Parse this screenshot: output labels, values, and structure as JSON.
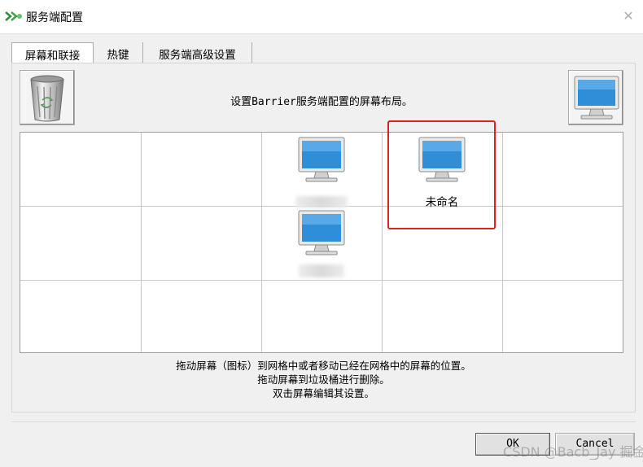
{
  "window": {
    "title": "服务端配置",
    "close_glyph": "✕"
  },
  "tabs": [
    {
      "label": "屏幕和联接",
      "active": true
    },
    {
      "label": "热键",
      "active": false
    },
    {
      "label": "服务端高级设置",
      "active": false
    }
  ],
  "instruction": "设置Barrier服务端配置的屏幕布局。",
  "trash": {
    "icon": "trash-bin-icon"
  },
  "new_screen": {
    "icon": "monitor-icon"
  },
  "grid": {
    "columns": 5,
    "rows": 3,
    "screens": [
      {
        "row": 0,
        "col": 2,
        "label": "",
        "label_obscured": true
      },
      {
        "row": 0,
        "col": 3,
        "label": "未命名",
        "label_obscured": false
      },
      {
        "row": 1,
        "col": 2,
        "label": "",
        "label_obscured": true
      }
    ]
  },
  "help": {
    "line1": "拖动屏幕（图标）到网格中或者移动已经在网格中的屏幕的位置。",
    "line2": "拖动屏幕到垃圾桶进行删除。",
    "line3": "双击屏幕编辑其设置。"
  },
  "buttons": {
    "ok": "OK",
    "cancel": "Cancel"
  },
  "watermark": "CSDN @Bacb_Jay  掘金技术社区",
  "colors": {
    "highlight": "#e02020",
    "monitor_screen": "#2e8ed8",
    "grid_line": "#c8c8c8"
  }
}
